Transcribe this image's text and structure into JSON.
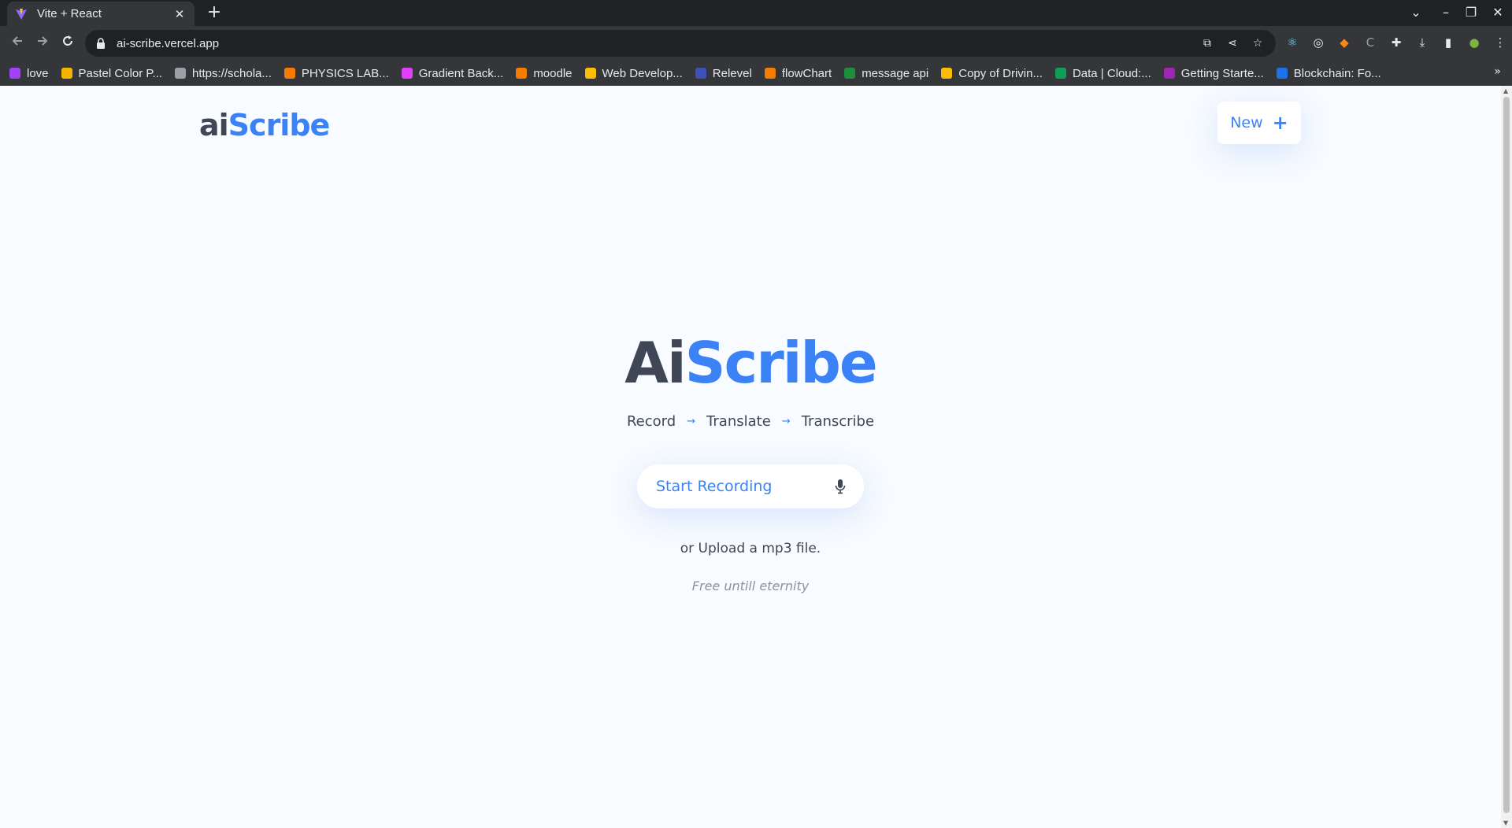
{
  "browser": {
    "tab_title": "Vite + React",
    "tab_close": "✕",
    "new_tab": "+",
    "url": "ai-scribe.vercel.app",
    "window_controls": [
      "⌄",
      "–",
      "❐",
      "✕"
    ],
    "bookmarks": [
      {
        "label": "love",
        "color": "#a142f4"
      },
      {
        "label": "Pastel Color P...",
        "color": "#f4b400"
      },
      {
        "label": "https://schola...",
        "color": "#9aa0a6"
      },
      {
        "label": "PHYSICS LAB...",
        "color": "#f57c00"
      },
      {
        "label": "Gradient Back...",
        "color": "#e040fb"
      },
      {
        "label": "moodle",
        "color": "#f57c00"
      },
      {
        "label": "Web Develop...",
        "color": "#fbbc04"
      },
      {
        "label": "Relevel",
        "color": "#3f51b5"
      },
      {
        "label": "flowChart",
        "color": "#f57c00"
      },
      {
        "label": "message api",
        "color": "#1e8e3e"
      },
      {
        "label": "Copy of Drivin...",
        "color": "#fbbc04"
      },
      {
        "label": "Data | Cloud:...",
        "color": "#0f9d58"
      },
      {
        "label": "Getting Starte...",
        "color": "#9c27b0"
      },
      {
        "label": "Blockchain: Fo...",
        "color": "#1a73e8"
      }
    ],
    "bookmarks_more": "»"
  },
  "app": {
    "brand_prefix": "ai",
    "brand_suffix": "Scribe",
    "new_button_label": "New",
    "new_button_icon": "plus-icon",
    "hero_prefix": "Ai",
    "hero_suffix": "Scribe",
    "steps": [
      "Record",
      "Translate",
      "Transcribe"
    ],
    "step_arrow": "→",
    "record_button_label": "Start Recording",
    "record_button_icon": "microphone-icon",
    "upload_text": "or Upload a mp3 file.",
    "tagline": "Free untill eternity",
    "colors": {
      "accent": "#3b82f6",
      "dark_text": "#3f4656",
      "background": "#f8fbff"
    }
  }
}
